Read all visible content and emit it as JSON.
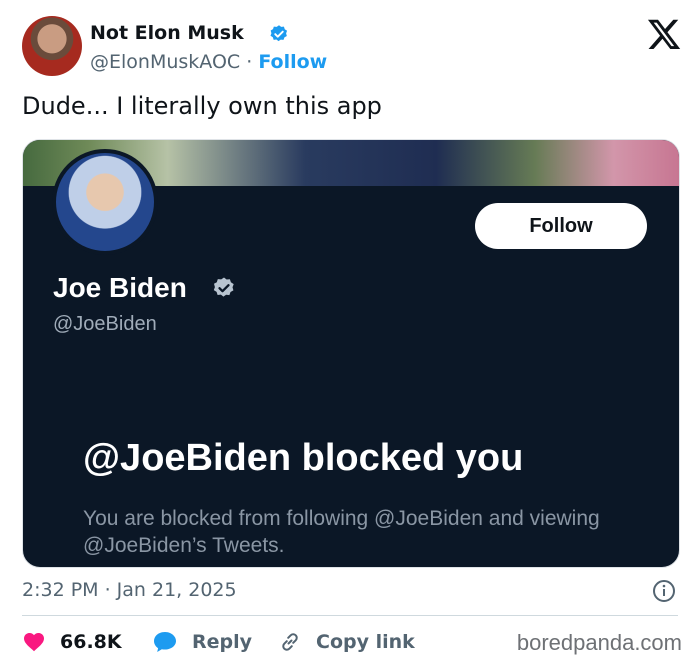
{
  "tweet": {
    "author_name": "Not Elon Musk",
    "author_handle": "@ElonMuskAOC",
    "separator": " · ",
    "follow_label": "Follow",
    "text": "Dude... I literally own this app",
    "timestamp": "2:32 PM · Jan 21, 2025",
    "likes": "66.8K",
    "reply_label": "Reply",
    "copy_link_label": "Copy link"
  },
  "embed": {
    "profile_name": "Joe Biden",
    "profile_handle": "@JoeBiden",
    "follow_button": "Follow",
    "blocked_title": "@JoeBiden blocked you",
    "blocked_desc": "You are blocked from following @JoeBiden and viewing @JoeBiden’s Tweets."
  },
  "watermark": "boredpanda.com",
  "colors": {
    "link_blue": "#1d9bf0",
    "like_pink": "#f91880",
    "verified_blue": "#1d9bf0",
    "embed_bg": "#0b1726"
  },
  "icons": [
    "verified-badge-icon",
    "x-logo-icon",
    "info-icon",
    "heart-icon",
    "reply-bubble-icon",
    "link-icon"
  ]
}
